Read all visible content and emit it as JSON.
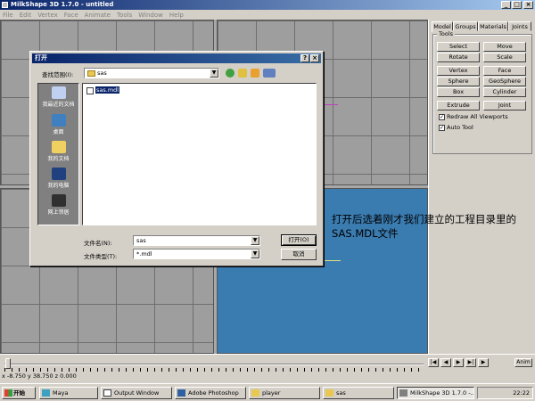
{
  "window": {
    "title": "MilkShape 3D 1.7.0 - untitled"
  },
  "menu": [
    "File",
    "Edit",
    "Vertex",
    "Face",
    "Animate",
    "Tools",
    "Window",
    "Help"
  ],
  "panel": {
    "tabs": [
      "Model",
      "Groups",
      "Materials",
      "Joints"
    ],
    "tools_label": "Tools",
    "tools": [
      [
        "Select",
        "Move"
      ],
      [
        "Rotate",
        "Scale"
      ],
      [
        "Vertex",
        "Face"
      ],
      [
        "Sphere",
        "GeoSphere"
      ],
      [
        "Box",
        "Cylinder"
      ],
      [
        "Extrude",
        "Joint"
      ]
    ],
    "checks": [
      "Redraw All Viewports",
      "Auto Tool"
    ]
  },
  "timeline": {
    "anim_label": "Anim",
    "coords": "x -8.750 y 38.750 z 0.000"
  },
  "dialog": {
    "title": "打开",
    "help_button": "?",
    "close_button": "×",
    "look_in_label": "查找范围(I):",
    "look_in_value": "sas",
    "places": [
      "我最近的文档",
      "桌面",
      "我的文档",
      "我的电脑",
      "网上邻居"
    ],
    "files": [
      "sas.mdl"
    ],
    "filename_label": "文件名(N):",
    "filename_value": "sas",
    "filetype_label": "文件类型(T):",
    "filetype_value": "*.mdl",
    "open_button": "打开(O)",
    "cancel_button": "取消"
  },
  "taskbar": {
    "start": "开始",
    "tasks": [
      "Maya",
      "Output Window",
      "Adobe Photoshop",
      "player",
      "sas",
      "MilkShape 3D 1.7.0 -..."
    ],
    "clock": "22:22"
  },
  "annotation": "打开后选着刚才我们建立的工程目录里的SAS.MDL文件",
  "colors": {
    "titlebar": "#0a246a",
    "viewport_blue": "#3a7bb0",
    "grid": "#9e9e9e",
    "selection": "#0a246a"
  }
}
